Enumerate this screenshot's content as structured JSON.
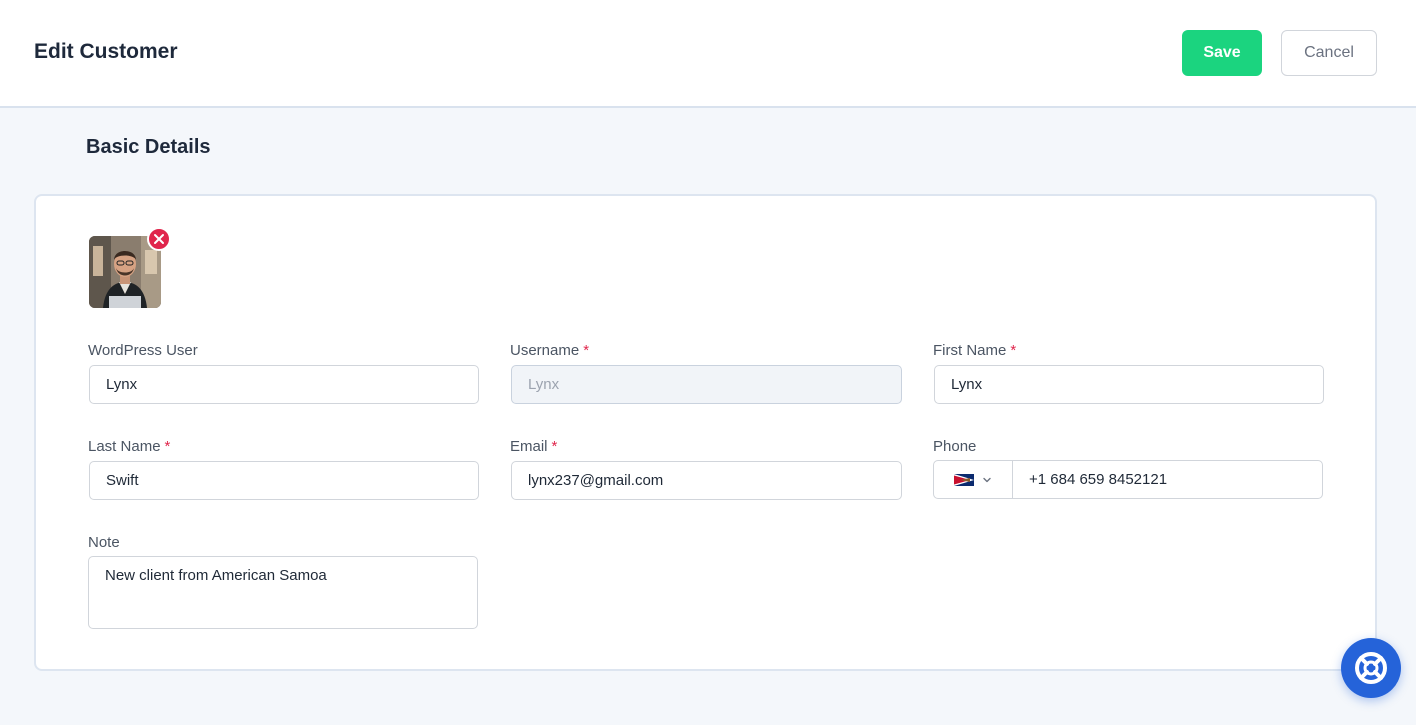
{
  "header": {
    "title": "Edit Customer",
    "save_label": "Save",
    "cancel_label": "Cancel"
  },
  "section": {
    "title": "Basic Details"
  },
  "form": {
    "wordpress_user": {
      "label": "WordPress User",
      "value": "Lynx"
    },
    "username": {
      "label": "Username",
      "required": "*",
      "value": "Lynx"
    },
    "first_name": {
      "label": "First Name",
      "required": "*",
      "value": "Lynx"
    },
    "last_name": {
      "label": "Last Name",
      "required": "*",
      "value": "Swift"
    },
    "email": {
      "label": "Email",
      "required": "*",
      "value": "lynx237@gmail.com"
    },
    "phone": {
      "label": "Phone",
      "country_flag": "american-samoa-flag",
      "value": "+1 684 659 8452121"
    },
    "note": {
      "label": "Note",
      "value": "New client from American Samoa"
    }
  },
  "colors": {
    "save": "#1bd47f",
    "required": "#e0264c",
    "remove": "#e0264c",
    "help": "#2563d9"
  },
  "icons": {
    "avatar_remove": "close-icon",
    "phone_dropdown": "chevron-down-icon",
    "help": "lifebuoy-icon"
  }
}
